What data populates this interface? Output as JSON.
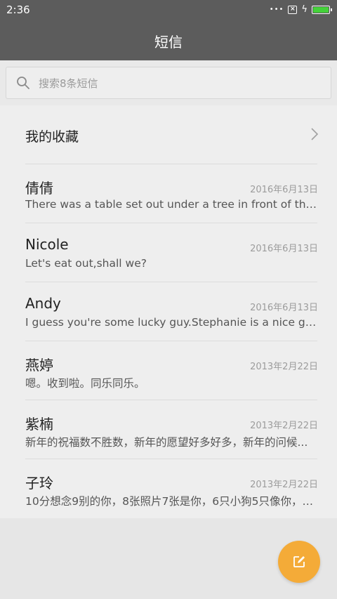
{
  "status_bar": {
    "time": "2:36",
    "battery_level": 1.0,
    "battery_color": "#44d13a"
  },
  "app_bar": {
    "title": "短信"
  },
  "search": {
    "placeholder": "搜索8条短信"
  },
  "favorites": {
    "label": "我的收藏"
  },
  "conversations": [
    {
      "name": "倩倩",
      "date": "2016年6月13日",
      "preview": "There was a table set out under a tree in front of the ho..."
    },
    {
      "name": "Nicole",
      "date": "2016年6月13日",
      "preview": "Let's eat out,shall we?"
    },
    {
      "name": "Andy",
      "date": "2016年6月13日",
      "preview": "I guess you're some lucky guy.Stephanie is a nice girl."
    },
    {
      "name": "燕婷",
      "date": "2013年2月22日",
      "preview": "嗯。收到啦。同乐同乐。"
    },
    {
      "name": "紫楠",
      "date": "2013年2月22日",
      "preview": "新年的祝福数不胜数，新年的愿望好多好多，新年的问候..."
    },
    {
      "name": "子玲",
      "date": "2013年2月22日",
      "preview": "10分想念9别的你，8张照片7张是你，6只小狗5只像你，4..."
    }
  ],
  "fab": {
    "icon": "compose-icon",
    "color": "#f4ab38"
  }
}
